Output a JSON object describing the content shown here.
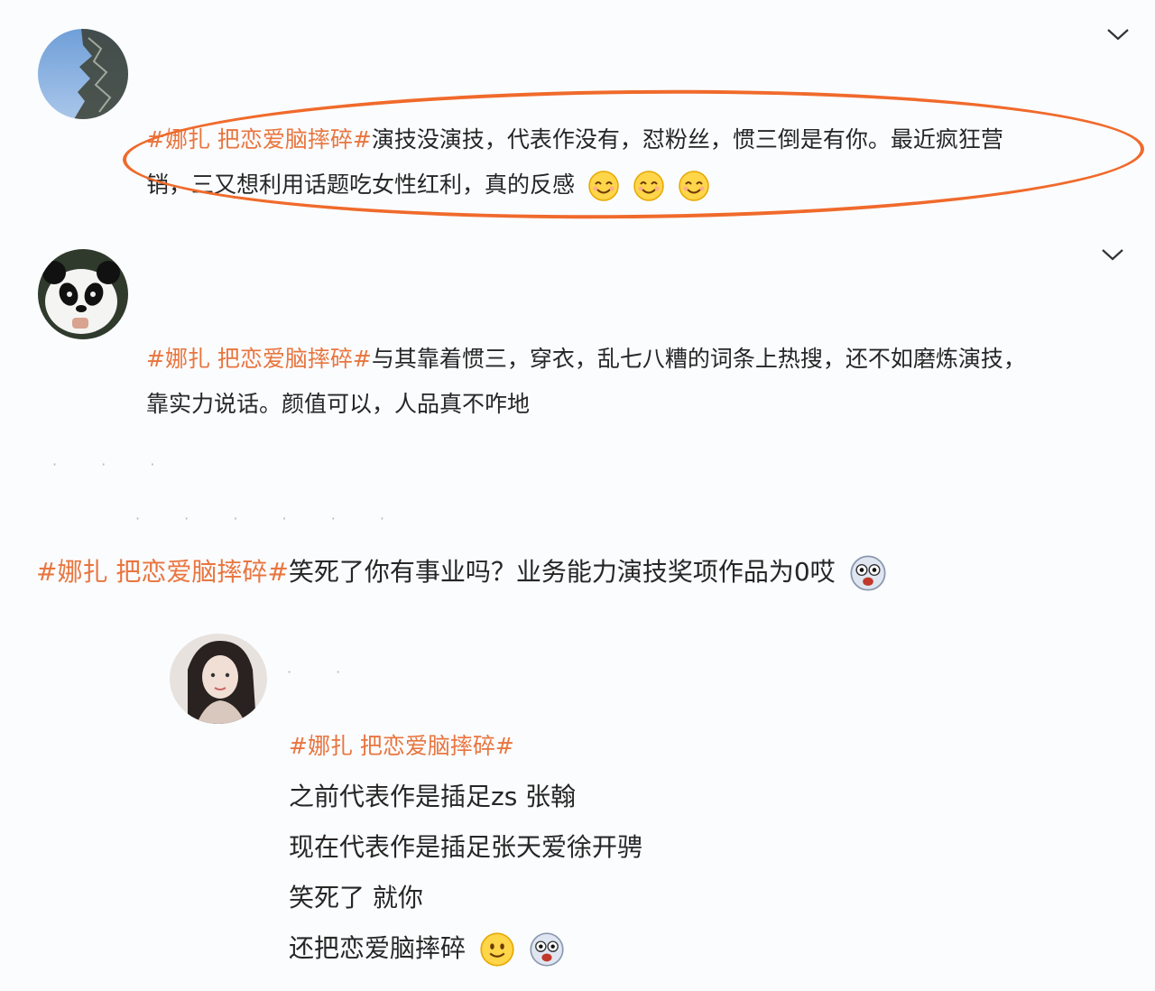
{
  "comments": [
    {
      "hashtag": "#娜扎 把恋爱脑摔碎#",
      "line1": "演技没演技，代表作没有，怼粉丝，惯三倒是有你。最近疯狂营",
      "line2": "销，三又想利用话题吃女性红利，真的反感"
    },
    {
      "hashtag": "#娜扎 把恋爱脑摔碎#",
      "line1": "与其靠着惯三，穿衣，乱七八糟的词条上热搜，还不如磨炼演技，",
      "line2": "靠实力说话。颜值可以，人品真不咋地"
    },
    {
      "hashtag": "#娜扎 把恋爱脑摔碎#",
      "line1": "笑死了你有事业吗？业务能力演技奖项作品为0哎"
    },
    {
      "hashtag": "#娜扎 把恋爱脑摔碎#",
      "lines": [
        "之前代表作是插足zs 张翰",
        "现在代表作是插足张天爱徐开骋",
        "笑死了 就你",
        "还把恋爱脑摔碎"
      ]
    }
  ],
  "icons": {
    "expand": "chevron-down-icon",
    "smile": "smile-emoji-icon",
    "shocked": "shocked-emoji-icon"
  },
  "colors": {
    "hashtag": "#e9753e",
    "highlight": "#f06a2b"
  }
}
